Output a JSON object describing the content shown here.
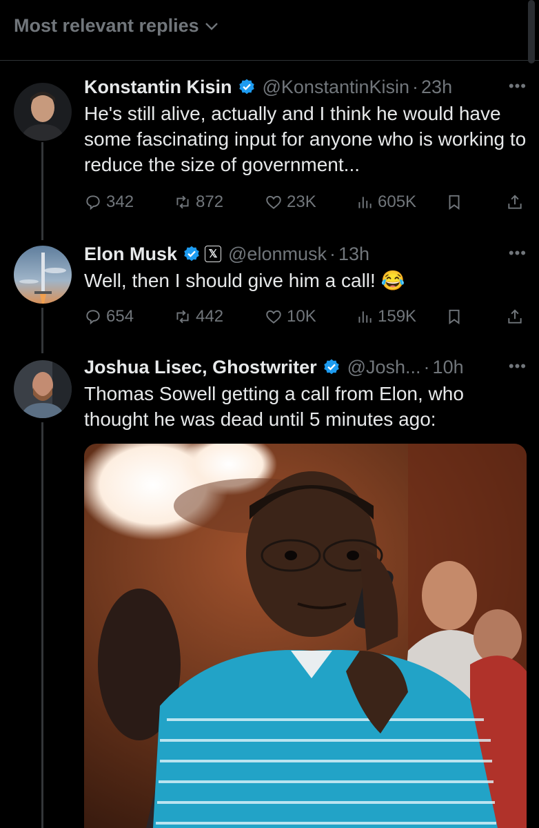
{
  "sort": {
    "label": "Most relevant replies"
  },
  "tweets": [
    {
      "name": "Konstantin Kisin",
      "handle": "@KonstantinKisin",
      "time": "23h",
      "text": "He's still alive, actually and I think he would have some fascinating input for anyone who is working to reduce the size of government...",
      "replies": "342",
      "reposts": "872",
      "likes": "23K",
      "views": "605K"
    },
    {
      "name": "Elon Musk",
      "handle": "@elonmusk",
      "time": "13h",
      "text": "Well, then I should give him a call! 😂",
      "replies": "654",
      "reposts": "442",
      "likes": "10K",
      "views": "159K"
    },
    {
      "name": "Joshua Lisec, Ghostwriter",
      "handle": "@Josh...",
      "time": "10h",
      "text": "Thomas Sowell getting a call from Elon, who thought he was dead until 5 minutes ago:"
    }
  ],
  "colors": {
    "background": "#000000",
    "text": "#e7e9ea",
    "muted": "#71767b",
    "verified": "#1d9bf0"
  }
}
